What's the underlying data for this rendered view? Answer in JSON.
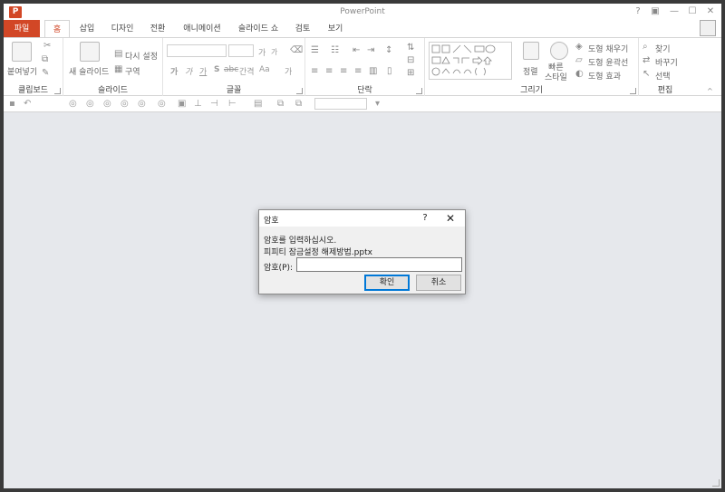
{
  "window": {
    "title": "PowerPoint",
    "app_icon": "P",
    "controls": {
      "help": "?",
      "ribbon_display": "▣",
      "minimize": "—",
      "restore": "☐",
      "close": "✕"
    }
  },
  "tabs": {
    "file": "파일",
    "items": [
      "홈",
      "삽입",
      "디자인",
      "전환",
      "애니메이션",
      "슬라이드 쇼",
      "검토",
      "보기"
    ],
    "active_index": 0
  },
  "ribbon": {
    "clipboard": {
      "label": "클립보드",
      "paste": "붙여넣기"
    },
    "slides": {
      "label": "슬라이드",
      "new_slide": "새 슬라이드",
      "reset": "다시 설정",
      "section": "구역"
    },
    "font": {
      "label": "글꼴",
      "bold": "가",
      "italic": "가",
      "underline": "가",
      "shadow": "S",
      "strike": "abc",
      "spacing": "간격",
      "case": "Aa",
      "color": "가",
      "grow": "가",
      "shrink": "가"
    },
    "paragraph": {
      "label": "단락"
    },
    "drawing": {
      "label": "그리기",
      "arrange": "정렬",
      "quick_styles": "빠른\n스타일",
      "shape_fill": "도형 채우기",
      "shape_outline": "도형 윤곽선",
      "shape_effects": "도형 효과"
    },
    "editing": {
      "label": "편집",
      "find": "찾기",
      "replace": "바꾸기",
      "select": "선택"
    }
  },
  "colors": {
    "accent": "#d24726",
    "workspace": "#e6e8ec",
    "dialog_bg": "#f0f0f0",
    "default_button_border": "#0078d7"
  },
  "dialog": {
    "title": "암호",
    "help": "?",
    "close": "✕",
    "prompt": "암호를 입력하십시오.",
    "filename": "피피티 잠금설정 해제방법.pptx",
    "password_label": "암호(P):",
    "password_value": "",
    "ok": "확인",
    "cancel": "취소"
  }
}
